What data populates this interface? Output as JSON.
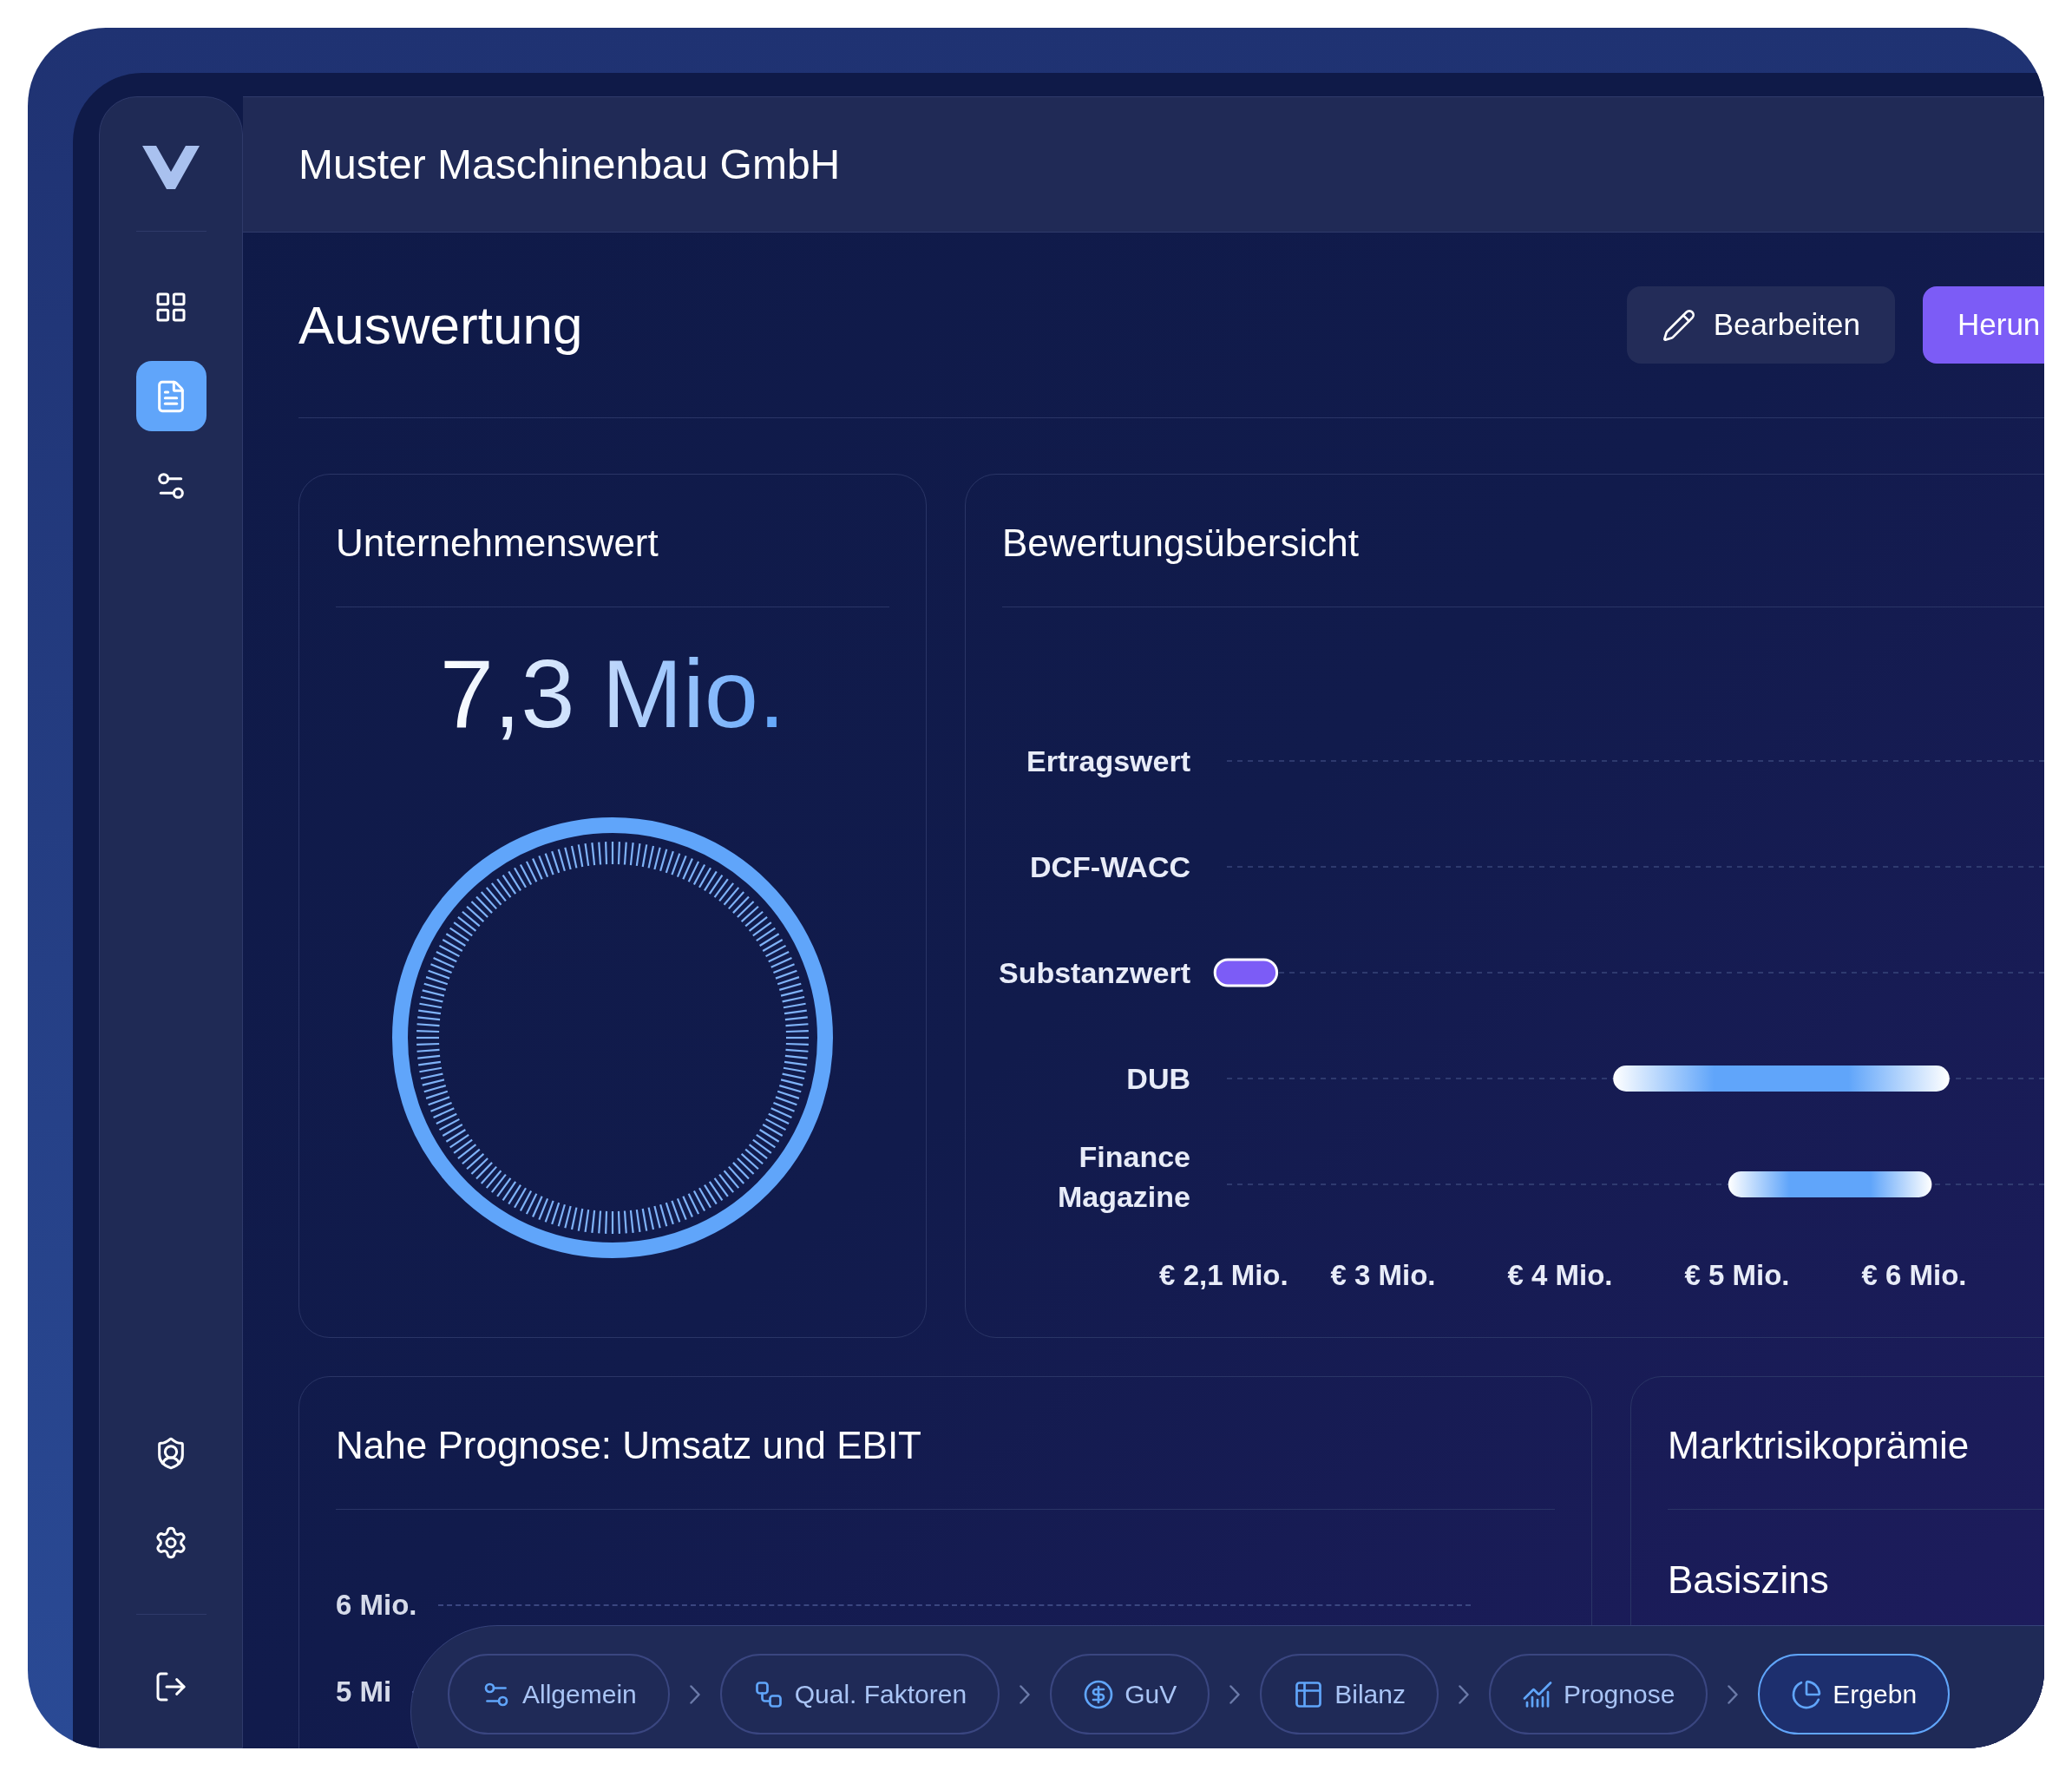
{
  "sidebar": {
    "top_items": [
      {
        "selected": false
      },
      {
        "selected": true
      },
      {
        "selected": false
      }
    ],
    "bottom_items": [
      {
        "selected": false
      },
      {
        "selected": false
      },
      {
        "selected": false
      }
    ]
  },
  "header": {
    "title": "Muster Maschinenbau GmbH"
  },
  "page": {
    "title": "Auswertung",
    "actions": [
      {
        "label": "Bearbeiten",
        "kind": "secondary"
      },
      {
        "label": "Herun",
        "kind": "primary"
      }
    ]
  },
  "enterprise_value": {
    "title": "Unternehmenswert",
    "value": "7,3 Mio."
  },
  "valuation_overview": {
    "title": "Bewertungsübersicht",
    "rows": [
      {
        "label": "Ertragswert"
      },
      {
        "label": "DCF-WACC"
      },
      {
        "label": "Substanzwert",
        "color": "#7c5cf6"
      },
      {
        "label": "DUB",
        "color": "#60a5fa"
      },
      {
        "label": "Finance Magazine",
        "color": "#60a5fa"
      }
    ],
    "axis_labels": [
      "€ 2,1 Mio.",
      "€ 3 Mio.",
      "€ 4 Mio.",
      "€ 5 Mio.",
      "€ 6 Mio."
    ]
  },
  "forecast": {
    "title": "Nahe Prognose: Umsatz und EBIT",
    "y_labels": [
      "6 Mio.",
      "5 Mi"
    ]
  },
  "market": {
    "title": "Marktrisikoprämie",
    "items": [
      "Basiszins"
    ]
  },
  "steps": [
    {
      "label": "Allgemein",
      "selected": false
    },
    {
      "label": "Qual. Faktoren",
      "selected": false
    },
    {
      "label": "GuV",
      "selected": false
    },
    {
      "label": "Bilanz",
      "selected": false
    },
    {
      "label": "Prognose",
      "selected": false
    },
    {
      "label": "Ergebn",
      "selected": true
    }
  ]
}
